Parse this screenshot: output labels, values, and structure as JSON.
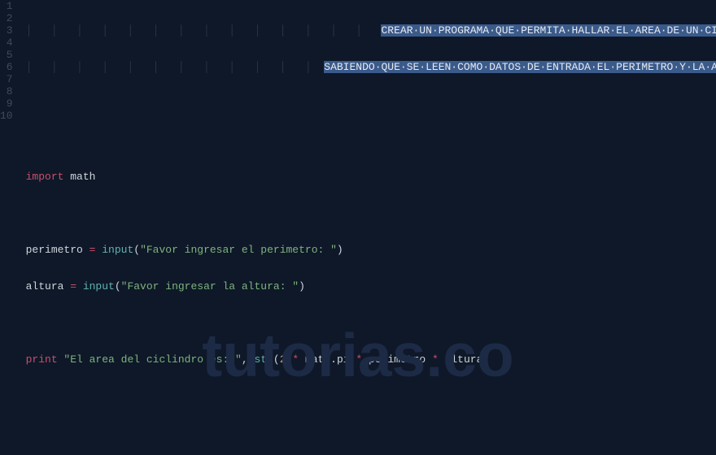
{
  "watermark": "tutorias.co",
  "line_numbers": [
    "1",
    "2",
    "3",
    "4",
    "5",
    "6",
    "7",
    "8",
    "9",
    "10"
  ],
  "comment": {
    "line1_sel": "CREAR·UN·PROGRAMA·QUE·PERMITA·HALLAR·EL·AREA·DE·UN·CILINDRO",
    "line2_sel": "SABIENDO·QUE·SE·LEEN·COMO·DATOS·DE·ENTRADA·EL·PERIMETRO·Y·LA·ALTURA"
  },
  "code": {
    "import_kw": "import",
    "import_mod": " math",
    "l7_id": "perimetro ",
    "l7_eq": "=",
    "l7_fn": " input",
    "l7_open": "(",
    "l7_str": "\"Favor ingresar el perimetro: \"",
    "l7_close": ")",
    "l8_id": "altura ",
    "l8_eq": "=",
    "l8_fn": " input",
    "l8_open": "(",
    "l8_str": "\"Favor ingresar la altura: \"",
    "l8_close": ")",
    "l10_print": "print",
    "l10_str": " \"El area del ciclindro es: \"",
    "l10_comma": ",",
    "l10_strfn": " str",
    "l10_open": "(",
    "l10_num": "2",
    "l10_mul1": " * ",
    "l10_mathpi": "math.pi",
    "l10_mul2": " * ",
    "l10_per": "perimetro",
    "l10_mul3": " * ",
    "l10_alt": "altura",
    "l10_close": ")"
  }
}
